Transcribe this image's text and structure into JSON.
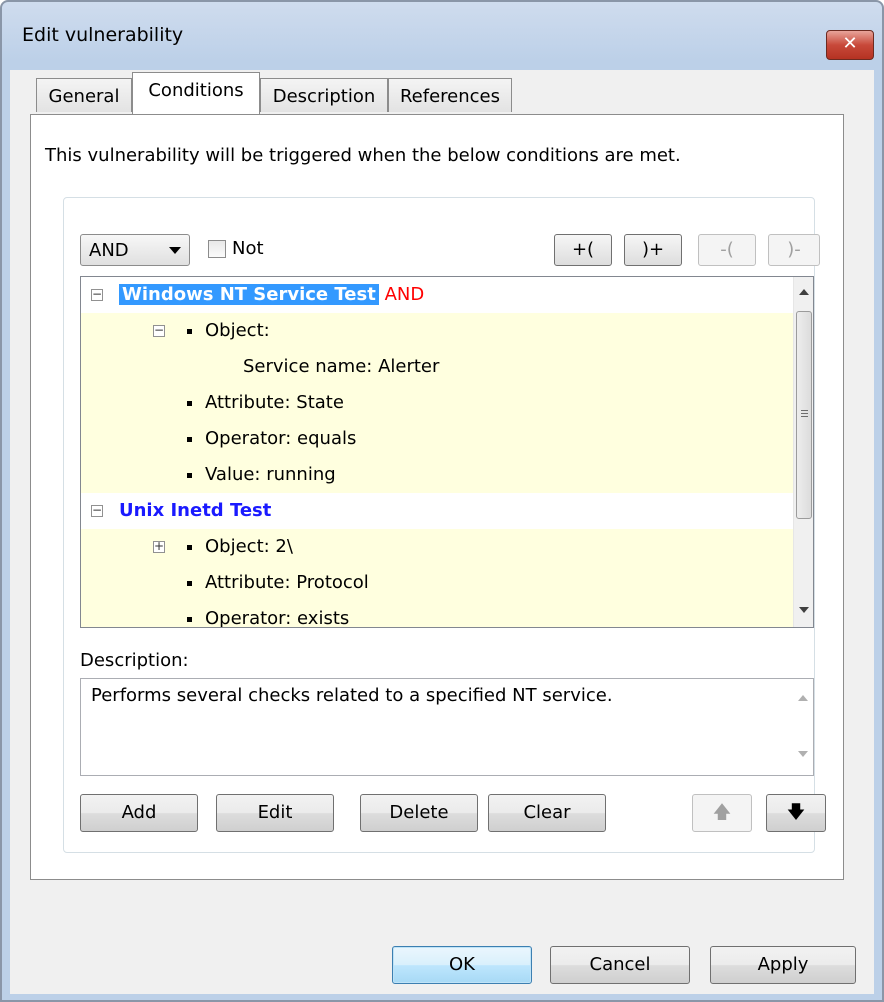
{
  "window": {
    "title": "Edit vulnerability",
    "close_label": "✕"
  },
  "tabs": [
    {
      "label": "General",
      "active": false
    },
    {
      "label": "Conditions",
      "active": true
    },
    {
      "label": "Description",
      "active": false
    },
    {
      "label": "References",
      "active": false
    }
  ],
  "intro_text": "This vulnerability will be triggered when the below conditions are met.",
  "operator_combo": {
    "value": "AND"
  },
  "not_checkbox": {
    "label": "Not",
    "checked": false
  },
  "paren_buttons": {
    "add_open": "+(",
    "add_close": ")+",
    "remove_open": "-(",
    "remove_close": ")-"
  },
  "tree": {
    "group1": {
      "title": "Windows NT Service Test",
      "joiner": "AND",
      "object_label": "Object:",
      "service_name": "Service name: Alerter",
      "attribute": "Attribute: State",
      "operator": "Operator: equals",
      "value": "Value: running"
    },
    "group2": {
      "title": "Unix Inetd Test",
      "object_label": "Object: 2\\",
      "attribute": "Attribute: Protocol",
      "operator": "Operator: exists"
    },
    "expand_minus": "−",
    "expand_plus": "+"
  },
  "description": {
    "label": "Description:",
    "text": "Performs several checks related to a specified NT service."
  },
  "action_buttons": {
    "add": "Add",
    "edit": "Edit",
    "delete": "Delete",
    "clear": "Clear",
    "move_up": "🡅",
    "move_down": "🡇"
  },
  "dialog_buttons": {
    "ok": "OK",
    "cancel": "Cancel",
    "apply": "Apply"
  },
  "colors": {
    "selection": "#3399ff",
    "group_title": "#1a1aff",
    "joiner": "#ff0000",
    "row_highlight": "#ffffdf"
  }
}
